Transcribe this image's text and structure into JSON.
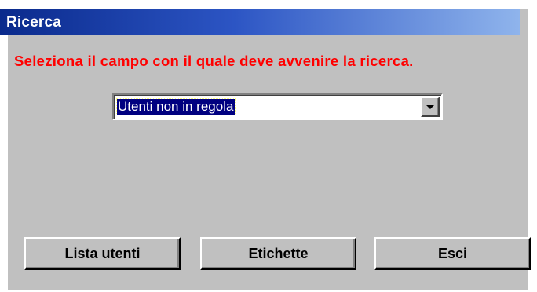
{
  "window": {
    "title": "Ricerca"
  },
  "prompt": {
    "text": "Seleziona il campo con il quale deve avvenire la ricerca.",
    "color": "#ff0000"
  },
  "search_field": {
    "selected_value": "Utenti non in regola",
    "dropdown_icon": "chevron-down-icon"
  },
  "buttons": {
    "lista_utenti": "Lista utenti",
    "etichette": "Etichette",
    "esci": "Esci"
  },
  "colors": {
    "titlebar_start": "#0a2a8c",
    "titlebar_end": "#8fb4ec",
    "dialog_background": "#c0c0c0",
    "selection_highlight": "#000080"
  }
}
